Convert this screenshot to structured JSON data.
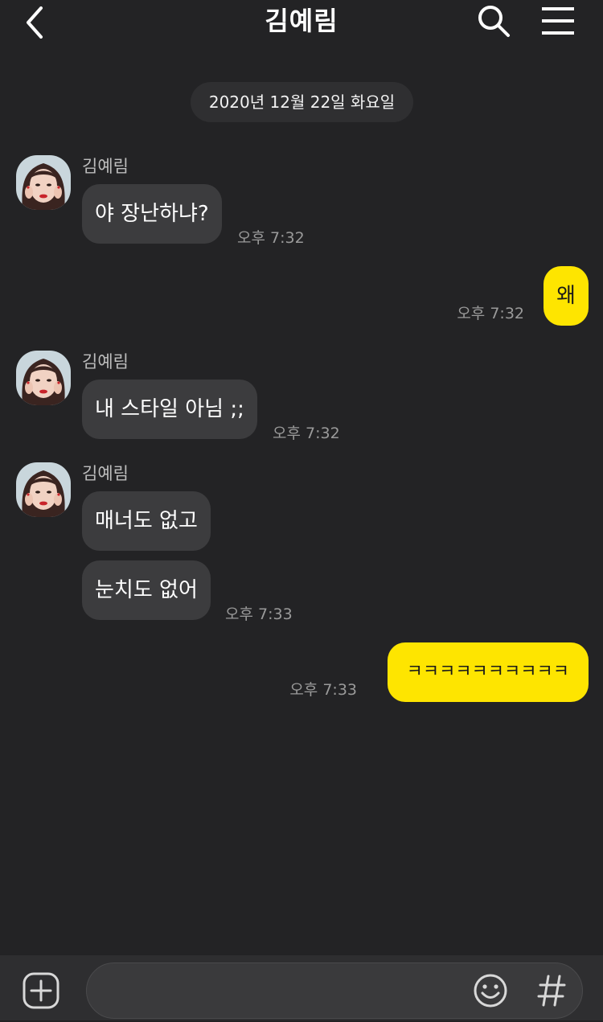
{
  "header": {
    "title": "김예림"
  },
  "date_divider": "2020년 12월 22일 화요일",
  "messages": [
    {
      "sender": "김예림",
      "text": "야 장난하냐?",
      "time": "오후 7:32",
      "mine": false
    },
    {
      "text": "왜",
      "time": "오후 7:32",
      "mine": true
    },
    {
      "sender": "김예림",
      "text": "내 스타일 아님 ;;",
      "time": "오후 7:32",
      "mine": false
    },
    {
      "sender": "김예림",
      "text": "매너도 없고",
      "mine": false
    },
    {
      "text": "눈치도 없어",
      "time": "오후 7:33",
      "mine": false
    },
    {
      "text": "ㅋㅋㅋㅋㅋㅋㅋㅋㅋㅋ",
      "time": "오후 7:33",
      "mine": true
    }
  ],
  "composer": {
    "placeholder": ""
  },
  "icons": {
    "back": "chevron-left-icon",
    "search": "search-icon",
    "menu": "hamburger-menu-icon",
    "plus": "plus-square-icon",
    "emoji": "emoji-smile-icon",
    "hash": "hashtag-icon"
  },
  "colors": {
    "background": "#232325",
    "my_bubble": "#fee500",
    "their_bubble": "#3c3c3e"
  }
}
